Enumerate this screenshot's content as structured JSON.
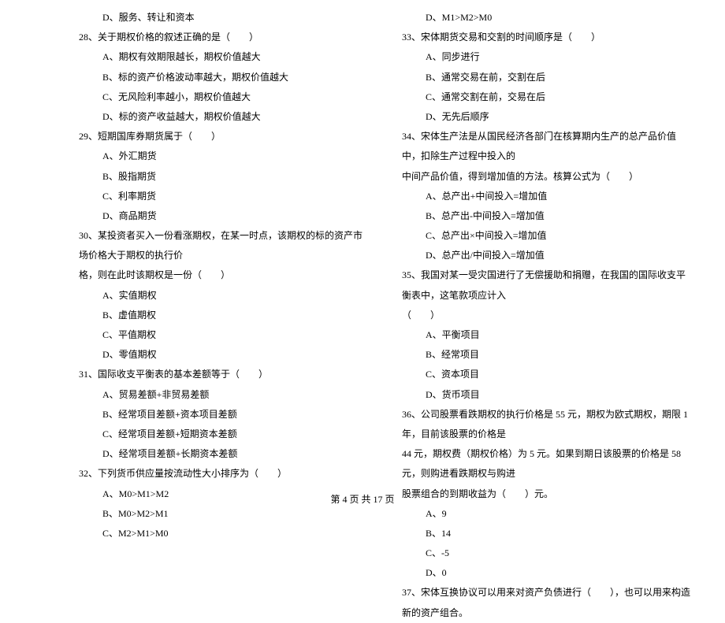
{
  "footer": "第 4 页  共 17 页",
  "left_column": [
    {
      "cls": "option-line",
      "text": "D、服务、转让和资本"
    },
    {
      "cls": "question-line",
      "text": "28、关于期权价格的叙述正确的是（　　）"
    },
    {
      "cls": "option-line",
      "text": "A、期权有效期限越长，期权价值越大"
    },
    {
      "cls": "option-line",
      "text": "B、标的资产价格波动率越大，期权价值越大"
    },
    {
      "cls": "option-line",
      "text": "C、无风险利率越小，期权价值越大"
    },
    {
      "cls": "option-line",
      "text": "D、标的资产收益越大，期权价值越大"
    },
    {
      "cls": "question-line",
      "text": "29、短期国库券期货属于（　　）"
    },
    {
      "cls": "option-line",
      "text": "A、外汇期货"
    },
    {
      "cls": "option-line",
      "text": "B、股指期货"
    },
    {
      "cls": "option-line",
      "text": "C、利率期货"
    },
    {
      "cls": "option-line",
      "text": "D、商品期货"
    },
    {
      "cls": "question-line",
      "text": "30、某投资者买入一份看涨期权，在某一时点，该期权的标的资产市场价格大于期权的执行价"
    },
    {
      "cls": "cont-line",
      "text": "格，则在此时该期权是一份（　　）"
    },
    {
      "cls": "option-line",
      "text": "A、实值期权"
    },
    {
      "cls": "option-line",
      "text": "B、虚值期权"
    },
    {
      "cls": "option-line",
      "text": "C、平值期权"
    },
    {
      "cls": "option-line",
      "text": "D、零值期权"
    },
    {
      "cls": "question-line",
      "text": "31、国际收支平衡表的基本差额等于（　　）"
    },
    {
      "cls": "option-line",
      "text": "A、贸易差额+非贸易差额"
    },
    {
      "cls": "option-line",
      "text": "B、经常项目差额+资本项目差额"
    },
    {
      "cls": "option-line",
      "text": "C、经常项目差额+短期资本差额"
    },
    {
      "cls": "option-line",
      "text": "D、经常项目差额+长期资本差额"
    },
    {
      "cls": "question-line",
      "text": "32、下列货币供应量按流动性大小排序为（　　）"
    },
    {
      "cls": "option-line",
      "text": "A、M0>M1>M2"
    },
    {
      "cls": "option-line",
      "text": "B、M0>M2>M1"
    },
    {
      "cls": "option-line",
      "text": "C、M2>M1>M0"
    }
  ],
  "right_column": [
    {
      "cls": "option-line",
      "text": "D、M1>M2>M0"
    },
    {
      "cls": "question-line",
      "text": "33、宋体期货交易和交割的时间顺序是（　　）"
    },
    {
      "cls": "option-line",
      "text": "A、同步进行"
    },
    {
      "cls": "option-line",
      "text": "B、通常交易在前，交割在后"
    },
    {
      "cls": "option-line",
      "text": "C、通常交割在前，交易在后"
    },
    {
      "cls": "option-line",
      "text": "D、无先后顺序"
    },
    {
      "cls": "question-line",
      "text": "34、宋体生产法是从国民经济各部门在核算期内生产的总产品价值中，扣除生产过程中投入的"
    },
    {
      "cls": "cont-line",
      "text": "中间产品价值，得到增加值的方法。核算公式为（　　）"
    },
    {
      "cls": "option-line",
      "text": "A、总产出+中间投入=增加值"
    },
    {
      "cls": "option-line",
      "text": "B、总产出-中间投入=增加值"
    },
    {
      "cls": "option-line",
      "text": "C、总产出×中间投入=增加值"
    },
    {
      "cls": "option-line",
      "text": "D、总产出/中间投入=增加值"
    },
    {
      "cls": "question-line",
      "text": "35、我国对某一受灾国进行了无偿援助和捐赠，在我国的国际收支平衡表中，这笔款项应计入"
    },
    {
      "cls": "cont-line",
      "text": "（　　）"
    },
    {
      "cls": "option-line",
      "text": "A、平衡项目"
    },
    {
      "cls": "option-line",
      "text": "B、经常项目"
    },
    {
      "cls": "option-line",
      "text": "C、资本项目"
    },
    {
      "cls": "option-line",
      "text": "D、货币项目"
    },
    {
      "cls": "question-line",
      "text": "36、公司股票看跌期权的执行价格是 55 元，期权为欧式期权，期限 1 年，目前该股票的价格是"
    },
    {
      "cls": "cont-line",
      "text": "44 元，期权费（期权价格）为 5 元。如果到期日该股票的价格是 58 元，则购进看跌期权与购进"
    },
    {
      "cls": "cont-line",
      "text": "股票组合的到期收益为（　　）元。"
    },
    {
      "cls": "option-line",
      "text": "A、9"
    },
    {
      "cls": "option-line",
      "text": "B、14"
    },
    {
      "cls": "option-line",
      "text": "C、-5"
    },
    {
      "cls": "option-line",
      "text": "D、0"
    },
    {
      "cls": "question-line",
      "text": "37、宋体互换协议可以用来对资产负债进行（　　），也可以用来构造新的资产组合。"
    }
  ]
}
